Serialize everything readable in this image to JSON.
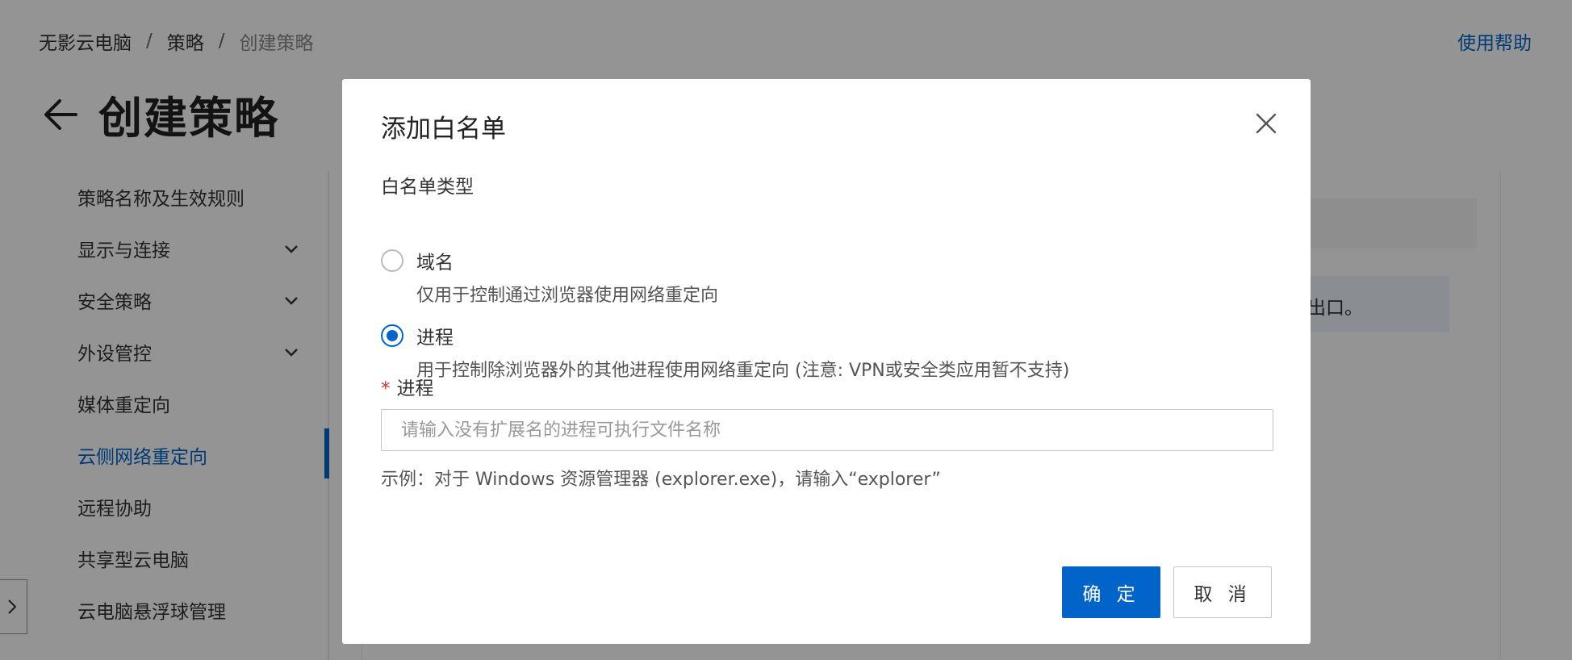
{
  "breadcrumb": {
    "items": [
      "无影云电脑",
      "策略"
    ],
    "current": "创建策略",
    "separator": "/"
  },
  "header": {
    "help_link": "使用帮助",
    "page_title": "创建策略"
  },
  "sidebar": {
    "items": [
      {
        "label": "策略名称及生效规则",
        "has_chevron": false,
        "active": false
      },
      {
        "label": "显示与连接",
        "has_chevron": true,
        "active": false
      },
      {
        "label": "安全策略",
        "has_chevron": true,
        "active": false
      },
      {
        "label": "外设管控",
        "has_chevron": true,
        "active": false
      },
      {
        "label": "媒体重定向",
        "has_chevron": false,
        "active": false
      },
      {
        "label": "云侧网络重定向",
        "has_chevron": false,
        "active": true
      },
      {
        "label": "远程协助",
        "has_chevron": false,
        "active": false
      },
      {
        "label": "共享型云电脑",
        "has_chevron": false,
        "active": false
      },
      {
        "label": "云电脑悬浮球管理",
        "has_chevron": false,
        "active": false
      }
    ]
  },
  "content": {
    "notice_fragment": "出口。"
  },
  "modal": {
    "title": "添加白名单",
    "type_label": "白名单类型",
    "options": [
      {
        "label": "域名",
        "desc": "仅用于控制通过浏览器使用网络重定向",
        "checked": false
      },
      {
        "label": "进程",
        "desc": "用于控制除浏览器外的其他进程使用网络重定向 (注意: VPN或安全类应用暂不支持)",
        "checked": true
      }
    ],
    "process_label": "进程",
    "required_mark": "*",
    "process_input": {
      "value": "",
      "placeholder": "请输入没有扩展名的进程可执行文件名称"
    },
    "hint": "示例：对于 Windows 资源管理器 (explorer.exe)，请输入“explorer”",
    "ok_label": "确 定",
    "cancel_label": "取 消"
  },
  "colors": {
    "accent": "#0064c8",
    "required": "#d93026",
    "overlay": "rgba(0,0,0,0.42)"
  }
}
